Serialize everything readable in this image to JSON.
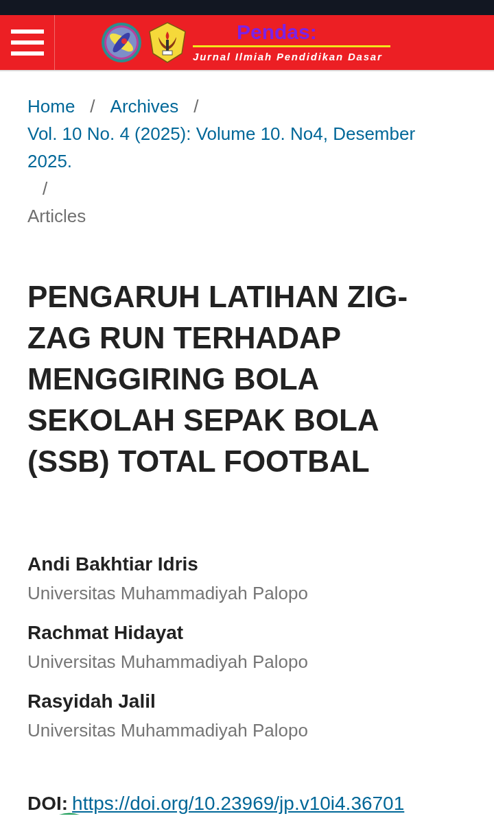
{
  "header": {
    "title": "Pendas:",
    "subtitle": "Jurnal Ilmiah Pendidikan Dasar"
  },
  "breadcrumbs": [
    {
      "kind": "link",
      "label": "Home",
      "separator": "/"
    },
    {
      "kind": "link",
      "label": "Archives",
      "separator": "/"
    },
    {
      "kind": "link",
      "label": "Vol. 10 No. 4 (2025): Volume 10. No4, Desember 2025.",
      "separator": "/"
    },
    {
      "kind": "current",
      "label": "Articles"
    }
  ],
  "article": {
    "title": "PENGARUH LATIHAN ZIG-ZAG RUN TERHADAP MENGGIRING BOLA SEKOLAH SEPAK BOLA (SSB) TOTAL FOOTBAL",
    "authors": [
      {
        "name": "Andi Bakhtiar Idris",
        "affiliation": "Universitas Muhammadiyah Palopo"
      },
      {
        "name": "Rachmat Hidayat",
        "affiliation": "Universitas Muhammadiyah Palopo"
      },
      {
        "name": "Rasyidah Jalil",
        "affiliation": "Universitas Muhammadiyah Palopo"
      }
    ],
    "doi": {
      "label": "DOI:",
      "url": "https://doi.org/10.23969/jp.v10i4.36701"
    }
  }
}
